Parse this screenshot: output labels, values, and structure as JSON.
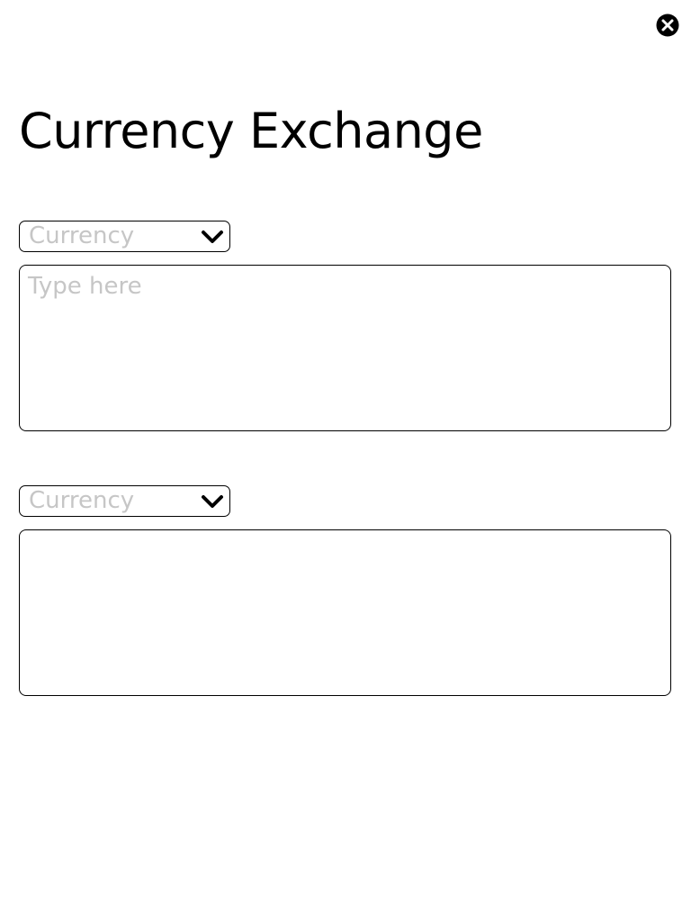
{
  "window": {
    "close_icon": "close-circle-icon",
    "title": "Currency Exchange"
  },
  "from": {
    "currency_select": {
      "value": "",
      "placeholder": "Currency",
      "icon": "chevron-down-icon"
    },
    "amount_input": {
      "value": "",
      "placeholder": "Type here"
    }
  },
  "to": {
    "currency_select": {
      "value": "",
      "placeholder": "Currency",
      "icon": "chevron-down-icon"
    },
    "result_output": {
      "value": ""
    }
  },
  "colors": {
    "text": "#000000",
    "placeholder": "#c6c6c6",
    "border": "#000000",
    "background": "#ffffff"
  }
}
